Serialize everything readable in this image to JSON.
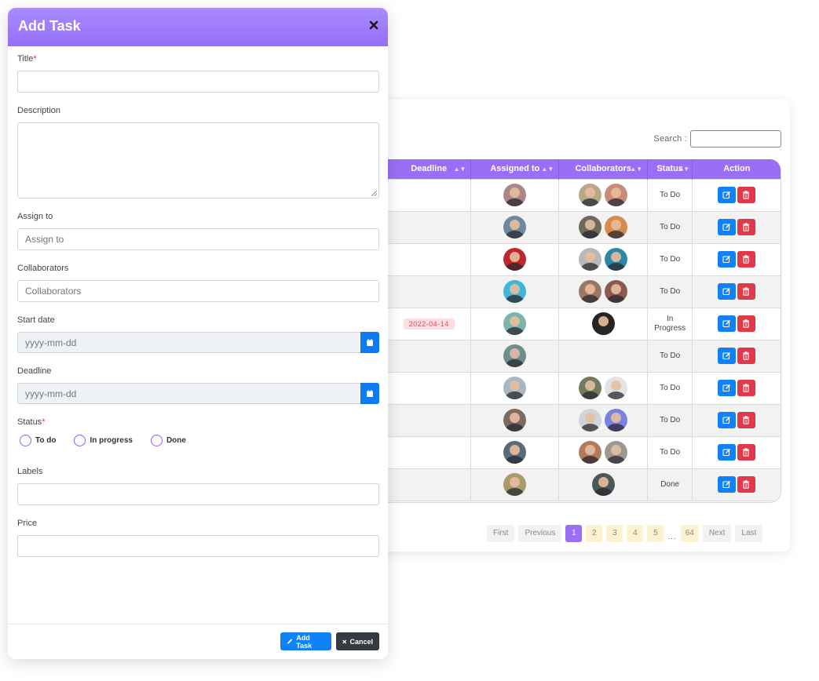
{
  "modal": {
    "title": "Add Task",
    "fields": {
      "title": {
        "label": "Title",
        "required": "*",
        "value": ""
      },
      "description": {
        "label": "Description",
        "value": ""
      },
      "assign_to": {
        "label": "Assign to",
        "placeholder": "Assign to"
      },
      "collaborators": {
        "label": "Collaborators",
        "placeholder": "Collaborators"
      },
      "start_date": {
        "label": "Start date",
        "placeholder": "yyyy-mm-dd"
      },
      "deadline": {
        "label": "Deadline",
        "placeholder": "yyyy-mm-dd"
      },
      "status": {
        "label": "Status",
        "required": "*",
        "options": [
          "To do",
          "In progress",
          "Done"
        ]
      },
      "labels": {
        "label": "Labels",
        "value": ""
      },
      "price": {
        "label": "Price",
        "value": ""
      }
    },
    "footer": {
      "add_label": "Add Task",
      "cancel_label": "Cancel"
    }
  },
  "table": {
    "search_label": "Search :",
    "columns": [
      "Deadline",
      "Assigned to",
      "Collaborators",
      "Status",
      "Action"
    ],
    "rows": [
      {
        "deadline": "",
        "assigned": [
          "#a88"
        ],
        "collaborators": [
          "#b9a78a",
          "#c98b7a"
        ],
        "status": "To Do"
      },
      {
        "deadline": "",
        "assigned": [
          "#6b8aa0"
        ],
        "collaborators": [
          "#6f6a5c",
          "#d88c4a"
        ],
        "status": "To Do"
      },
      {
        "deadline": "",
        "assigned": [
          "#c0262c"
        ],
        "collaborators": [
          "#b8b8b8",
          "#2f86a6"
        ],
        "status": "To Do"
      },
      {
        "deadline": "",
        "assigned": [
          "#3fb6d3"
        ],
        "collaborators": [
          "#9a7760",
          "#8b5a4e"
        ],
        "status": "To Do"
      },
      {
        "deadline": "2022-04-14",
        "assigned": [
          "#7fb3ad"
        ],
        "collaborators": [
          "#2a2320"
        ],
        "status": "In Progress"
      },
      {
        "deadline": "",
        "assigned": [
          "#6c8f8c"
        ],
        "collaborators": [],
        "status": "To Do"
      },
      {
        "deadline": "",
        "assigned": [
          "#a9b7c0"
        ],
        "collaborators": [
          "#6f7d5a",
          "#e3e3e3"
        ],
        "status": "To Do"
      },
      {
        "deadline": "",
        "assigned": [
          "#7a6a60"
        ],
        "collaborators": [
          "#cfd5d8",
          "#7b7fe0"
        ],
        "status": "To Do"
      },
      {
        "deadline": "",
        "assigned": [
          "#5d6b78"
        ],
        "collaborators": [
          "#b47a5e",
          "#9a9a92"
        ],
        "status": "To Do"
      },
      {
        "deadline": "",
        "assigned": [
          "#a89a6a"
        ],
        "collaborators": [
          "#4a5a5a"
        ],
        "status": "Done"
      }
    ]
  },
  "pagination": {
    "first": "First",
    "previous": "Previous",
    "pages": [
      "1",
      "2",
      "3",
      "4",
      "5"
    ],
    "ellipsis": "...",
    "last_page": "64",
    "next": "Next",
    "last": "Last",
    "current": "1"
  },
  "colors": {
    "accent": "#9b6ff5",
    "primary": "#1181f7",
    "danger": "#e03a4a",
    "dark": "#343a40"
  }
}
